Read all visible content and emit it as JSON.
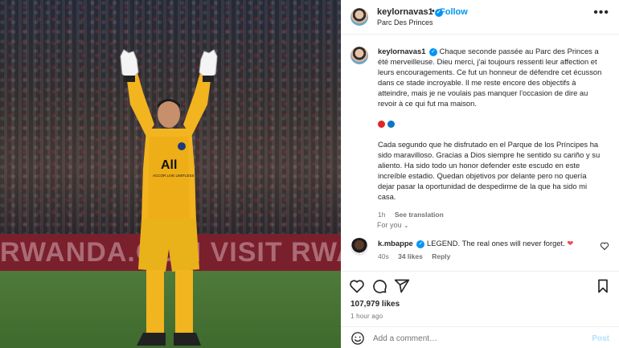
{
  "photo": {
    "ad_text": "RWANDA.COM  VISIT RWANDA",
    "jersey_brand": "All",
    "jersey_sub": "ACCOR LIVE LIMITLESS"
  },
  "header": {
    "username": "keylornavas1",
    "follow_label": "Follow",
    "location": "Parc Des Princes",
    "dot": "•",
    "more": "•••"
  },
  "caption": {
    "username": "keylornavas1",
    "text_fr": "Chaque seconde passée au Parc des Princes a été merveilleuse. Dieu merci, j'ai toujours ressenti leur affection et leurs encouragements. Ce fut un honneur de défendre cet écusson dans ce stade incroyable. Il me reste encore des objectifs à atteindre, mais je ne voulais pas manquer l'occasion de dire au revoir à ce qui fut ma maison.",
    "text_es": "Cada segundo que he disfrutado en el Parque de los Príncipes ha sido maravilloso. Gracias a Dios siempre he sentido su cariño y su aliento. Ha sido todo un honor defender este escudo en este increíble estadio. Quedan objetivos por delante pero no quería dejar pasar la oportunidad de despedirme de la que ha sido mi casa.",
    "age": "1h",
    "see_translation": "See translation",
    "flag_colors": [
      "#e0262b",
      "#0a76c4"
    ]
  },
  "for_you": "For you",
  "reply": {
    "username": "k.mbappe",
    "text": "LEGEND. The real ones will never forget.",
    "age": "40s",
    "likes": "34 likes",
    "reply_label": "Reply"
  },
  "likes": "107,979 likes",
  "time": "1 hour ago",
  "add_comment": {
    "placeholder": "Add a comment…",
    "post_label": "Post"
  },
  "colors": {
    "accent": "#0095f6",
    "heart": "#ed4956",
    "muted": "#737373"
  }
}
